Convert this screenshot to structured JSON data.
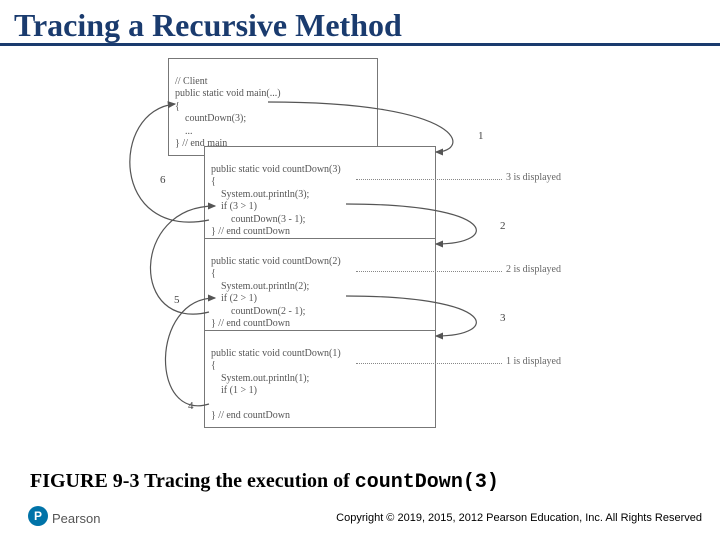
{
  "title": "Tracing a Recursive Method",
  "boxes": {
    "client": {
      "comment": "// Client",
      "sig": "public static void main(...)",
      "open": "{",
      "call": "    countDown(3);",
      "ell": "    ...",
      "close": "} // end main"
    },
    "cd3": {
      "sig": "public static void countDown(3)",
      "open": "{",
      "print": "    System.out.println(3);",
      "ifln": "    if (3 > 1)",
      "rec": "        countDown(3 - 1);",
      "close": "} // end countDown"
    },
    "cd2": {
      "sig": "public static void countDown(2)",
      "open": "{",
      "print": "    System.out.println(2);",
      "ifln": "    if (2 > 1)",
      "rec": "        countDown(2 - 1);",
      "close": "} // end countDown"
    },
    "cd1": {
      "sig": "public static void countDown(1)",
      "open": "{",
      "print": "    System.out.println(1);",
      "ifln": "    if (1 > 1)",
      "blank": "",
      "close": "} // end countDown"
    }
  },
  "displayed": {
    "d3": "3 is displayed",
    "d2": "2 is displayed",
    "d1": "1 is displayed"
  },
  "labels": {
    "n1": "1",
    "n2": "2",
    "n3": "3",
    "n4": "4",
    "n5": "5",
    "n6": "6"
  },
  "caption_prefix": "FIGURE 9-3 Tracing the execution of ",
  "caption_code": "countDown(3)",
  "brand_letter": "P",
  "brand_name": "Pearson",
  "copyright": "Copyright © 2019, 2015, 2012 Pearson Education, Inc. All Rights Reserved"
}
